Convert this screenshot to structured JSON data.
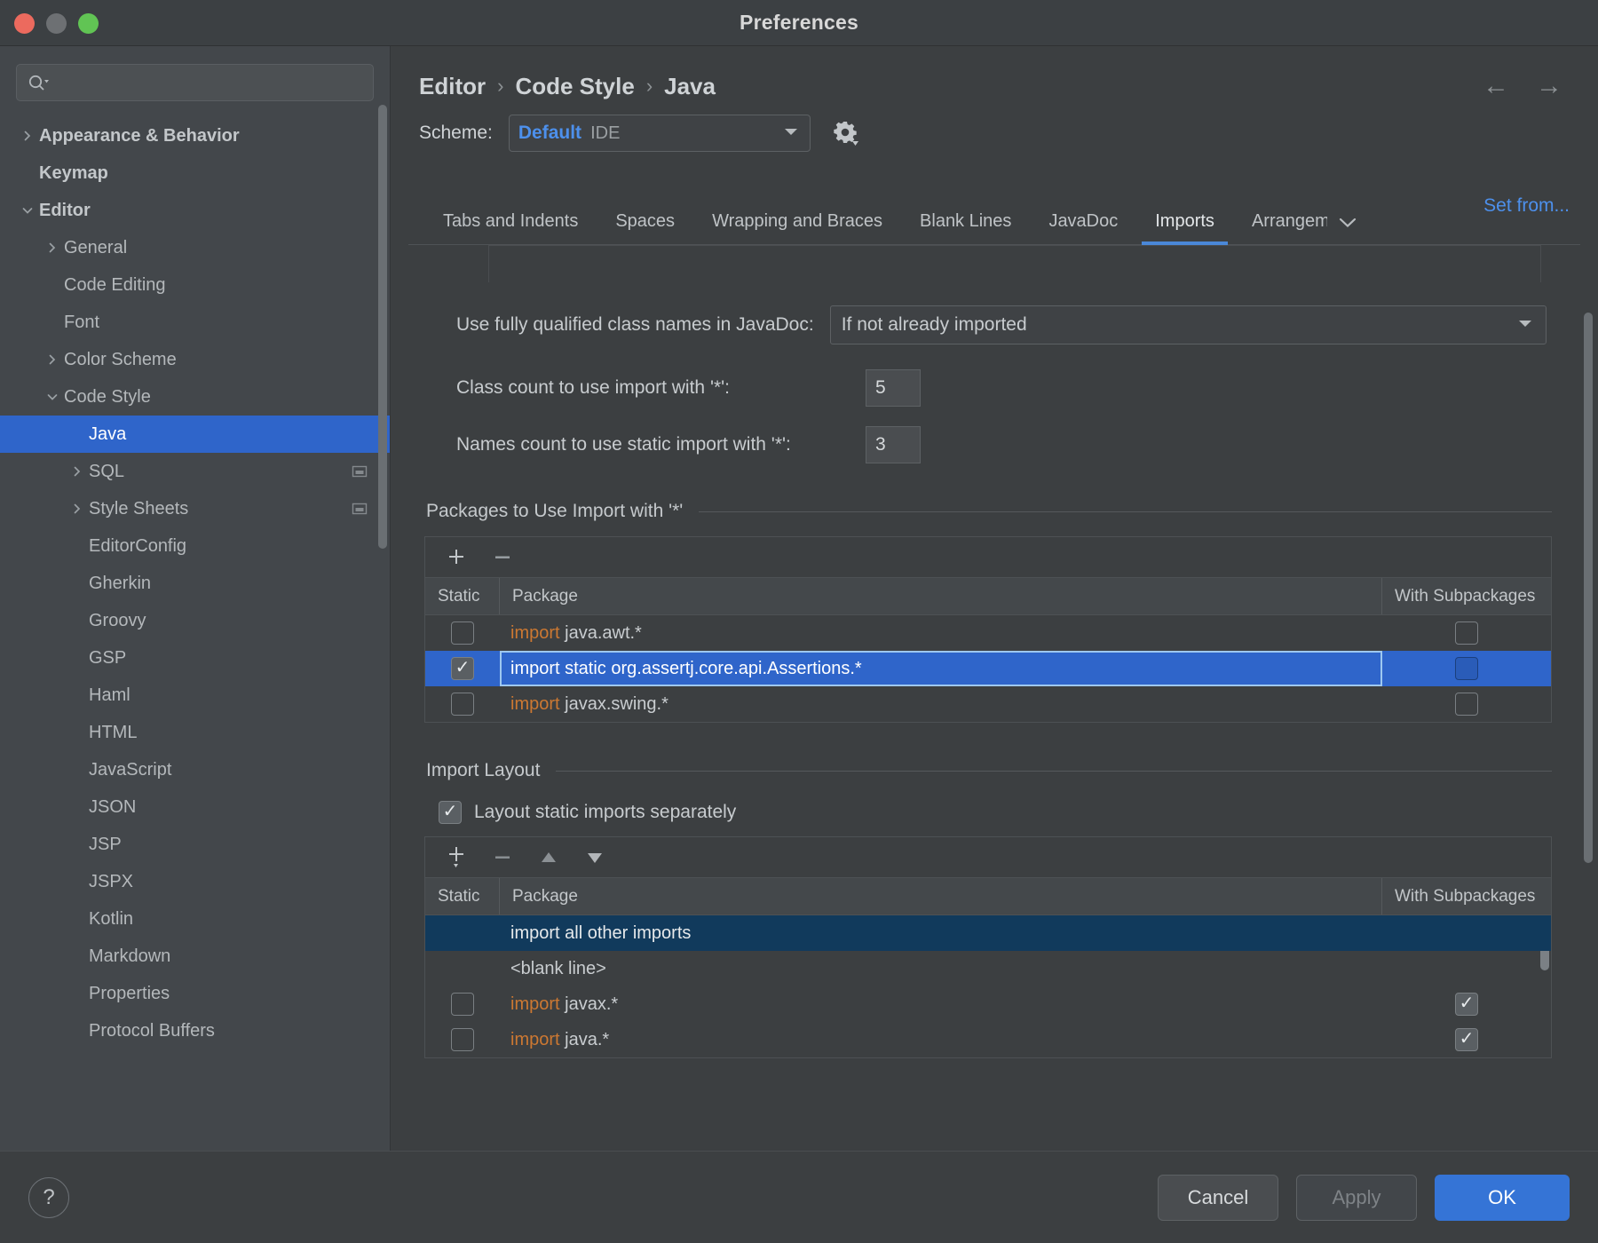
{
  "window": {
    "title": "Preferences",
    "traffic_lights": [
      "close",
      "minimize",
      "zoom"
    ]
  },
  "sidebar": {
    "search": {
      "value": "",
      "placeholder": ""
    },
    "items": [
      {
        "label": "Appearance & Behavior",
        "arrow": "collapsed",
        "indent": 0,
        "bold": true,
        "selected": false,
        "trailing": false
      },
      {
        "label": "Keymap",
        "arrow": "none",
        "indent": 0,
        "bold": true,
        "selected": false,
        "trailing": false
      },
      {
        "label": "Editor",
        "arrow": "expanded",
        "indent": 0,
        "bold": true,
        "selected": false,
        "trailing": false
      },
      {
        "label": "General",
        "arrow": "collapsed",
        "indent": 1,
        "bold": false,
        "selected": false,
        "trailing": false
      },
      {
        "label": "Code Editing",
        "arrow": "none",
        "indent": 1,
        "bold": false,
        "selected": false,
        "trailing": false
      },
      {
        "label": "Font",
        "arrow": "none",
        "indent": 1,
        "bold": false,
        "selected": false,
        "trailing": false
      },
      {
        "label": "Color Scheme",
        "arrow": "collapsed",
        "indent": 1,
        "bold": false,
        "selected": false,
        "trailing": false
      },
      {
        "label": "Code Style",
        "arrow": "expanded",
        "indent": 1,
        "bold": false,
        "selected": false,
        "trailing": false
      },
      {
        "label": "Java",
        "arrow": "none",
        "indent": 2,
        "bold": false,
        "selected": true,
        "trailing": false
      },
      {
        "label": "SQL",
        "arrow": "collapsed",
        "indent": 2,
        "bold": false,
        "selected": false,
        "trailing": true
      },
      {
        "label": "Style Sheets",
        "arrow": "collapsed",
        "indent": 2,
        "bold": false,
        "selected": false,
        "trailing": true
      },
      {
        "label": "EditorConfig",
        "arrow": "none",
        "indent": 2,
        "bold": false,
        "selected": false,
        "trailing": false
      },
      {
        "label": "Gherkin",
        "arrow": "none",
        "indent": 2,
        "bold": false,
        "selected": false,
        "trailing": false
      },
      {
        "label": "Groovy",
        "arrow": "none",
        "indent": 2,
        "bold": false,
        "selected": false,
        "trailing": false
      },
      {
        "label": "GSP",
        "arrow": "none",
        "indent": 2,
        "bold": false,
        "selected": false,
        "trailing": false
      },
      {
        "label": "Haml",
        "arrow": "none",
        "indent": 2,
        "bold": false,
        "selected": false,
        "trailing": false
      },
      {
        "label": "HTML",
        "arrow": "none",
        "indent": 2,
        "bold": false,
        "selected": false,
        "trailing": false
      },
      {
        "label": "JavaScript",
        "arrow": "none",
        "indent": 2,
        "bold": false,
        "selected": false,
        "trailing": false
      },
      {
        "label": "JSON",
        "arrow": "none",
        "indent": 2,
        "bold": false,
        "selected": false,
        "trailing": false
      },
      {
        "label": "JSP",
        "arrow": "none",
        "indent": 2,
        "bold": false,
        "selected": false,
        "trailing": false
      },
      {
        "label": "JSPX",
        "arrow": "none",
        "indent": 2,
        "bold": false,
        "selected": false,
        "trailing": false
      },
      {
        "label": "Kotlin",
        "arrow": "none",
        "indent": 2,
        "bold": false,
        "selected": false,
        "trailing": false
      },
      {
        "label": "Markdown",
        "arrow": "none",
        "indent": 2,
        "bold": false,
        "selected": false,
        "trailing": false
      },
      {
        "label": "Properties",
        "arrow": "none",
        "indent": 2,
        "bold": false,
        "selected": false,
        "trailing": false
      },
      {
        "label": "Protocol Buffers",
        "arrow": "none",
        "indent": 2,
        "bold": false,
        "selected": false,
        "trailing": false
      }
    ]
  },
  "header": {
    "breadcrumb": [
      "Editor",
      "Code Style",
      "Java"
    ],
    "breadcrumb_separator": "›",
    "back_arrow": "←",
    "forward_arrow": "→",
    "scheme_label": "Scheme:",
    "scheme_value": "Default",
    "scheme_scope": "IDE",
    "set_from_link": "Set from..."
  },
  "tabs": {
    "items": [
      {
        "label": "Tabs and Indents",
        "active": false
      },
      {
        "label": "Spaces",
        "active": false
      },
      {
        "label": "Wrapping and Braces",
        "active": false
      },
      {
        "label": "Blank Lines",
        "active": false
      },
      {
        "label": "JavaDoc",
        "active": false
      },
      {
        "label": "Imports",
        "active": true
      },
      {
        "label": "Arrangem",
        "active": false
      }
    ],
    "overflow_icon": "chevron-down-icon"
  },
  "settings": {
    "fq_label": "Use fully qualified class names in JavaDoc:",
    "fq_value": "If not already imported",
    "class_count_label": "Class count to use import with '*':",
    "class_count_value": "5",
    "names_count_label": "Names count to use static import with '*':",
    "names_count_value": "3"
  },
  "packages_section": {
    "title": "Packages to Use Import with '*'",
    "toolbar": {
      "add": "+",
      "remove": "−"
    },
    "columns": [
      "Static",
      "Package",
      "With Subpackages"
    ],
    "rows": [
      {
        "static_checked": false,
        "keyword": "import",
        "package": " java.awt.*",
        "subpackages_checked": false,
        "selected": false,
        "editing": false
      },
      {
        "static_checked": true,
        "keyword": "",
        "package": "import static org.assertj.core.api.Assertions.*",
        "subpackages_checked": false,
        "selected": true,
        "editing": true
      },
      {
        "static_checked": false,
        "keyword": "import",
        "package": " javax.swing.*",
        "subpackages_checked": false,
        "selected": false,
        "editing": false
      }
    ]
  },
  "import_layout_section": {
    "title": "Import Layout",
    "checkbox_label": "Layout static imports separately",
    "checkbox_checked": true,
    "toolbar": {
      "add": "+",
      "remove": "−",
      "up": "▲",
      "down": "▼"
    },
    "columns": [
      "Static",
      "Package",
      "With Subpackages"
    ],
    "rows": [
      {
        "static_checked": null,
        "keyword": "",
        "package": "import all other imports",
        "subpackages_checked": null,
        "selected": true,
        "muted": false
      },
      {
        "static_checked": null,
        "keyword": "",
        "package": "<blank line>",
        "subpackages_checked": null,
        "selected": false,
        "muted": true
      },
      {
        "static_checked": false,
        "keyword": "import",
        "package": " javax.*",
        "subpackages_checked": true,
        "selected": false,
        "muted": false
      },
      {
        "static_checked": false,
        "keyword": "import",
        "package": " java.*",
        "subpackages_checked": true,
        "selected": false,
        "muted": false
      }
    ]
  },
  "footer": {
    "help": "?",
    "cancel": "Cancel",
    "apply": "Apply",
    "ok": "OK"
  },
  "colors": {
    "accent_blue": "#2f65ca",
    "link_blue": "#4d90ec",
    "keyword_orange": "#cc7832",
    "primary_button": "#3574d6",
    "window_bg": "#3c3f41",
    "sidebar_bg": "#43474b"
  }
}
